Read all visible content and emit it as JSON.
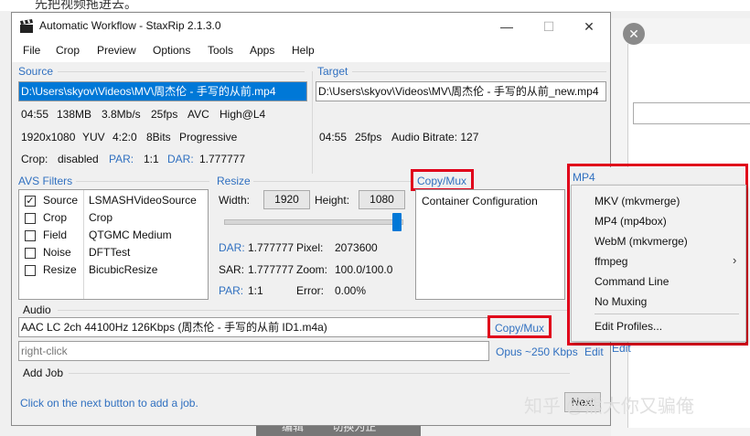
{
  "background": {
    "top_text": "先把视频拖进去。",
    "close_icon": "close-icon",
    "bottom_left": "编辑",
    "bottom_right": "切换为正"
  },
  "window": {
    "title": "Automatic Workflow - StaxRip 2.1.3.0",
    "minimize": "—",
    "maximize": "☐",
    "close": "✕"
  },
  "menu": [
    "File",
    "Crop",
    "Preview",
    "Options",
    "Tools",
    "Apps",
    "Help"
  ],
  "source": {
    "label": "Source",
    "path": "D:\\Users\\skyov\\Videos\\MV\\周杰伦 - 手写的从前.mp4",
    "row1": [
      "04:55",
      "138MB",
      "3.8Mb/s",
      "25fps",
      "AVC",
      "High@L4"
    ],
    "row2": [
      "1920x1080",
      "YUV",
      "4:2:0",
      "8Bits",
      "Progressive"
    ],
    "row3": {
      "crop_label": "Crop:",
      "crop_value": "disabled",
      "par_label": "PAR:",
      "par_value": "1:1",
      "dar_label": "DAR:",
      "dar_value": "1.777777"
    }
  },
  "target": {
    "label": "Target",
    "path": "D:\\Users\\skyov\\Videos\\MV\\周杰伦 - 手写的从前_new.mp4",
    "row": [
      "04:55",
      "25fps",
      "Audio Bitrate: 127"
    ]
  },
  "avs": {
    "label": "AVS Filters",
    "filters": [
      {
        "checked": true,
        "name": "Source",
        "value": "LSMASHVideoSource"
      },
      {
        "checked": false,
        "name": "Crop",
        "value": "Crop"
      },
      {
        "checked": false,
        "name": "Field",
        "value": "QTGMC Medium"
      },
      {
        "checked": false,
        "name": "Noise",
        "value": "DFTTest"
      },
      {
        "checked": false,
        "name": "Resize",
        "value": "BicubicResize"
      }
    ]
  },
  "resize": {
    "label": "Resize",
    "width_label": "Width:",
    "width_value": "1920",
    "height_label": "Height:",
    "height_value": "1080",
    "slider_level": 1.0,
    "dar_label": "DAR:",
    "dar_value": "1.777777",
    "pixel_label": "Pixel:",
    "pixel_value": "2073600",
    "sar_label": "SAR:",
    "sar_value": "1.777777",
    "zoom_label": "Zoom:",
    "zoom_value": "100.0/100.0",
    "par_label": "PAR:",
    "par_value": "1:1",
    "error_label": "Error:",
    "error_value": "0.00%"
  },
  "container": {
    "label": "Copy/Mux",
    "text": "Container Configuration"
  },
  "mp4": {
    "label": "MP4",
    "items": [
      "MKV (mkvmerge)",
      "MP4 (mp4box)",
      "WebM (mkvmerge)",
      "ffmpeg",
      "Command Line",
      "No Muxing",
      "Edit Profiles..."
    ]
  },
  "audio": {
    "label": "Audio",
    "track1": "AAC LC 2ch 44100Hz 126Kbps (周杰伦 - 手写的从前 ID1.m4a)",
    "track1_link": "Copy/Mux",
    "track1_edit": "Edit",
    "track2": "right-click",
    "track2_link": "Opus ~250 Kbps",
    "track2_edit": "Edit"
  },
  "job": {
    "label": "Add Job",
    "hint": "Click on the next button to add a job.",
    "next": "Next"
  },
  "watermark": "知乎 @熊大你又骗俺",
  "colors": {
    "accent": "#3070c0",
    "highlight": "#e0001a",
    "selection": "#0078d7"
  }
}
